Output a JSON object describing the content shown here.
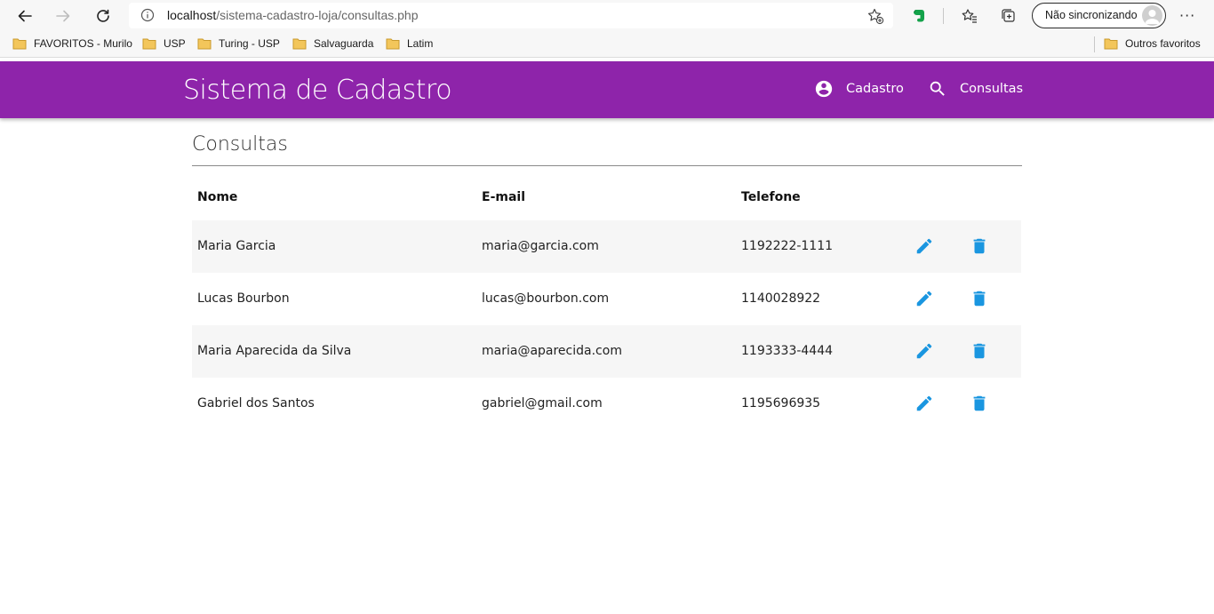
{
  "browser": {
    "url_host": "localhost",
    "url_path": "/sistema-cadastro-loja/consultas.php",
    "profile_label": "Não sincronizando",
    "more_label": "···",
    "bookmarks": [
      "FAVORITOS - Murilo",
      "USP",
      "Turing - USP",
      "Salvaguarda",
      "Latim"
    ],
    "other_favorites": "Outros favoritos"
  },
  "header": {
    "title": "Sistema de Cadastro",
    "nav": [
      {
        "label": "Cadastro",
        "icon": "account-circle-icon"
      },
      {
        "label": "Consultas",
        "icon": "search-icon"
      }
    ],
    "color": "#8e24aa"
  },
  "main": {
    "heading": "Consultas",
    "columns": [
      "Nome",
      "E-mail",
      "Telefone"
    ],
    "rows": [
      {
        "nome": "Maria Garcia",
        "email": "maria@garcia.com",
        "telefone": "1192222-1111"
      },
      {
        "nome": "Lucas Bourbon",
        "email": "lucas@bourbon.com",
        "telefone": "1140028922"
      },
      {
        "nome": "Maria Aparecida da Silva",
        "email": "maria@aparecida.com",
        "telefone": "1193333-4444"
      },
      {
        "nome": "Gabriel dos Santos",
        "email": "gabriel@gmail.com",
        "telefone": "1195696935"
      }
    ],
    "action_icons": [
      "edit-icon",
      "delete-icon"
    ],
    "action_color": "#1a96e0"
  }
}
